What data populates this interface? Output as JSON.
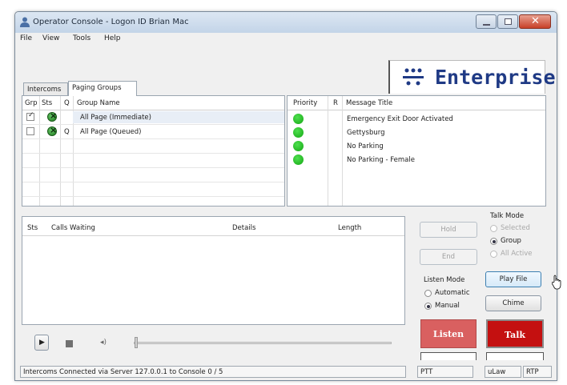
{
  "window": {
    "title": "Operator Console - Logon ID Brian Mac"
  },
  "menu": [
    "File",
    "View",
    "Tools",
    "Help"
  ],
  "logo": {
    "text": "Enterprise"
  },
  "tabs": [
    "Intercoms",
    "Paging Groups"
  ],
  "groups_table": {
    "columns": [
      "Grp",
      "Sts",
      "Q",
      "Group Name"
    ],
    "rows": [
      {
        "checked": true,
        "q": "",
        "name": "All Page (Immediate)"
      },
      {
        "checked": false,
        "q": "Q",
        "name": "All Page (Queued)"
      }
    ]
  },
  "messages_table": {
    "columns": [
      "Priority",
      "R",
      "Message Title"
    ],
    "rows": [
      {
        "title": "Emergency Exit Door Activated"
      },
      {
        "title": "Gettysburg"
      },
      {
        "title": "No Parking"
      },
      {
        "title": "No Parking - Female"
      }
    ]
  },
  "calls_table": {
    "columns": [
      "Sts",
      "Calls Waiting",
      "Details",
      "Length"
    ]
  },
  "buttons": {
    "hold": "Hold",
    "end": "End",
    "play_file": "Play File",
    "chime": "Chime",
    "listen": "Listen",
    "talk": "Talk"
  },
  "talk_mode": {
    "label": "Talk Mode",
    "options": [
      "Selected",
      "Group",
      "All Active"
    ],
    "selected": "Group"
  },
  "listen_mode": {
    "label": "Listen Mode",
    "options": [
      "Automatic",
      "Manual"
    ],
    "selected": "Manual"
  },
  "status_bar": {
    "message": "Intercoms Connected via Server 127.0.0.1 to Console 0 / 5",
    "ptt": "PTT",
    "codec": "uLaw",
    "protocol": "RTP"
  },
  "colors": {
    "listen": "#d96060",
    "talk": "#c41010",
    "status_green": "#19b019",
    "logo_blue": "#1f3a85"
  }
}
